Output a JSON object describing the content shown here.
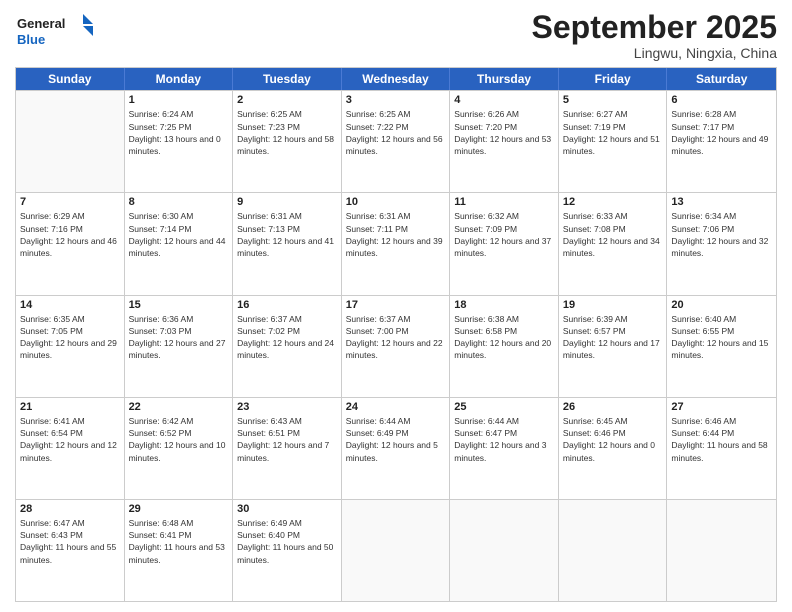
{
  "header": {
    "logo_line1": "General",
    "logo_line2": "Blue",
    "month_title": "September 2025",
    "location": "Lingwu, Ningxia, China"
  },
  "days_of_week": [
    "Sunday",
    "Monday",
    "Tuesday",
    "Wednesday",
    "Thursday",
    "Friday",
    "Saturday"
  ],
  "weeks": [
    [
      {
        "day": "",
        "sunrise": "",
        "sunset": "",
        "daylight": ""
      },
      {
        "day": "1",
        "sunrise": "Sunrise: 6:24 AM",
        "sunset": "Sunset: 7:25 PM",
        "daylight": "Daylight: 13 hours and 0 minutes."
      },
      {
        "day": "2",
        "sunrise": "Sunrise: 6:25 AM",
        "sunset": "Sunset: 7:23 PM",
        "daylight": "Daylight: 12 hours and 58 minutes."
      },
      {
        "day": "3",
        "sunrise": "Sunrise: 6:25 AM",
        "sunset": "Sunset: 7:22 PM",
        "daylight": "Daylight: 12 hours and 56 minutes."
      },
      {
        "day": "4",
        "sunrise": "Sunrise: 6:26 AM",
        "sunset": "Sunset: 7:20 PM",
        "daylight": "Daylight: 12 hours and 53 minutes."
      },
      {
        "day": "5",
        "sunrise": "Sunrise: 6:27 AM",
        "sunset": "Sunset: 7:19 PM",
        "daylight": "Daylight: 12 hours and 51 minutes."
      },
      {
        "day": "6",
        "sunrise": "Sunrise: 6:28 AM",
        "sunset": "Sunset: 7:17 PM",
        "daylight": "Daylight: 12 hours and 49 minutes."
      }
    ],
    [
      {
        "day": "7",
        "sunrise": "Sunrise: 6:29 AM",
        "sunset": "Sunset: 7:16 PM",
        "daylight": "Daylight: 12 hours and 46 minutes."
      },
      {
        "day": "8",
        "sunrise": "Sunrise: 6:30 AM",
        "sunset": "Sunset: 7:14 PM",
        "daylight": "Daylight: 12 hours and 44 minutes."
      },
      {
        "day": "9",
        "sunrise": "Sunrise: 6:31 AM",
        "sunset": "Sunset: 7:13 PM",
        "daylight": "Daylight: 12 hours and 41 minutes."
      },
      {
        "day": "10",
        "sunrise": "Sunrise: 6:31 AM",
        "sunset": "Sunset: 7:11 PM",
        "daylight": "Daylight: 12 hours and 39 minutes."
      },
      {
        "day": "11",
        "sunrise": "Sunrise: 6:32 AM",
        "sunset": "Sunset: 7:09 PM",
        "daylight": "Daylight: 12 hours and 37 minutes."
      },
      {
        "day": "12",
        "sunrise": "Sunrise: 6:33 AM",
        "sunset": "Sunset: 7:08 PM",
        "daylight": "Daylight: 12 hours and 34 minutes."
      },
      {
        "day": "13",
        "sunrise": "Sunrise: 6:34 AM",
        "sunset": "Sunset: 7:06 PM",
        "daylight": "Daylight: 12 hours and 32 minutes."
      }
    ],
    [
      {
        "day": "14",
        "sunrise": "Sunrise: 6:35 AM",
        "sunset": "Sunset: 7:05 PM",
        "daylight": "Daylight: 12 hours and 29 minutes."
      },
      {
        "day": "15",
        "sunrise": "Sunrise: 6:36 AM",
        "sunset": "Sunset: 7:03 PM",
        "daylight": "Daylight: 12 hours and 27 minutes."
      },
      {
        "day": "16",
        "sunrise": "Sunrise: 6:37 AM",
        "sunset": "Sunset: 7:02 PM",
        "daylight": "Daylight: 12 hours and 24 minutes."
      },
      {
        "day": "17",
        "sunrise": "Sunrise: 6:37 AM",
        "sunset": "Sunset: 7:00 PM",
        "daylight": "Daylight: 12 hours and 22 minutes."
      },
      {
        "day": "18",
        "sunrise": "Sunrise: 6:38 AM",
        "sunset": "Sunset: 6:58 PM",
        "daylight": "Daylight: 12 hours and 20 minutes."
      },
      {
        "day": "19",
        "sunrise": "Sunrise: 6:39 AM",
        "sunset": "Sunset: 6:57 PM",
        "daylight": "Daylight: 12 hours and 17 minutes."
      },
      {
        "day": "20",
        "sunrise": "Sunrise: 6:40 AM",
        "sunset": "Sunset: 6:55 PM",
        "daylight": "Daylight: 12 hours and 15 minutes."
      }
    ],
    [
      {
        "day": "21",
        "sunrise": "Sunrise: 6:41 AM",
        "sunset": "Sunset: 6:54 PM",
        "daylight": "Daylight: 12 hours and 12 minutes."
      },
      {
        "day": "22",
        "sunrise": "Sunrise: 6:42 AM",
        "sunset": "Sunset: 6:52 PM",
        "daylight": "Daylight: 12 hours and 10 minutes."
      },
      {
        "day": "23",
        "sunrise": "Sunrise: 6:43 AM",
        "sunset": "Sunset: 6:51 PM",
        "daylight": "Daylight: 12 hours and 7 minutes."
      },
      {
        "day": "24",
        "sunrise": "Sunrise: 6:44 AM",
        "sunset": "Sunset: 6:49 PM",
        "daylight": "Daylight: 12 hours and 5 minutes."
      },
      {
        "day": "25",
        "sunrise": "Sunrise: 6:44 AM",
        "sunset": "Sunset: 6:47 PM",
        "daylight": "Daylight: 12 hours and 3 minutes."
      },
      {
        "day": "26",
        "sunrise": "Sunrise: 6:45 AM",
        "sunset": "Sunset: 6:46 PM",
        "daylight": "Daylight: 12 hours and 0 minutes."
      },
      {
        "day": "27",
        "sunrise": "Sunrise: 6:46 AM",
        "sunset": "Sunset: 6:44 PM",
        "daylight": "Daylight: 11 hours and 58 minutes."
      }
    ],
    [
      {
        "day": "28",
        "sunrise": "Sunrise: 6:47 AM",
        "sunset": "Sunset: 6:43 PM",
        "daylight": "Daylight: 11 hours and 55 minutes."
      },
      {
        "day": "29",
        "sunrise": "Sunrise: 6:48 AM",
        "sunset": "Sunset: 6:41 PM",
        "daylight": "Daylight: 11 hours and 53 minutes."
      },
      {
        "day": "30",
        "sunrise": "Sunrise: 6:49 AM",
        "sunset": "Sunset: 6:40 PM",
        "daylight": "Daylight: 11 hours and 50 minutes."
      },
      {
        "day": "",
        "sunrise": "",
        "sunset": "",
        "daylight": ""
      },
      {
        "day": "",
        "sunrise": "",
        "sunset": "",
        "daylight": ""
      },
      {
        "day": "",
        "sunrise": "",
        "sunset": "",
        "daylight": ""
      },
      {
        "day": "",
        "sunrise": "",
        "sunset": "",
        "daylight": ""
      }
    ]
  ]
}
